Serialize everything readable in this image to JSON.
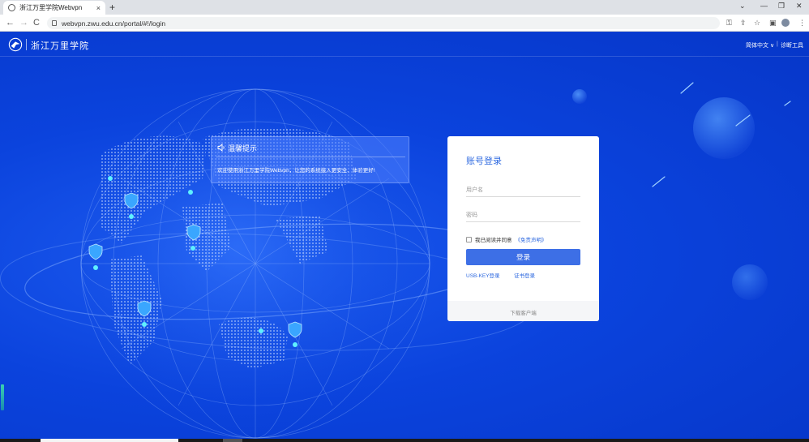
{
  "browser": {
    "tab_title": "浙江万里学院Webvpn",
    "tab_close": "×",
    "new_tab": "+",
    "url": "webvpn.zwu.edu.cn/portal/#!/login",
    "nav_back": "←",
    "nav_forward": "→",
    "nav_reload": "C",
    "win_chevron": "⌄",
    "win_minimize": "—",
    "win_restore": "❐",
    "win_close": "✕",
    "key_icon": "⚿",
    "share_icon": "⇪",
    "star_icon": "☆",
    "sidepanel_icon": "▣",
    "menu_icon": "⋮"
  },
  "header": {
    "site_name": "浙江万里学院",
    "language": "简体中文 ∨",
    "separator": "|",
    "diagnostics": "诊断工具"
  },
  "notice": {
    "title": "温馨提示",
    "text": "欢迎使用浙江万里学院Webvpn，让您的系统接入更安全、体验更好!"
  },
  "login": {
    "title": "账号登录",
    "username_placeholder": "用户名",
    "password_placeholder": "密码",
    "agree_text": "我已阅读并同意",
    "disclaimer": "《免责声明》",
    "button": "登录",
    "usbkey": "USB-KEY登录",
    "cert": "证书登录",
    "download": "下载客户端"
  },
  "colors": {
    "background": "#0a3fd6",
    "accent": "#3d6fe6",
    "link": "#2f6ae0"
  }
}
